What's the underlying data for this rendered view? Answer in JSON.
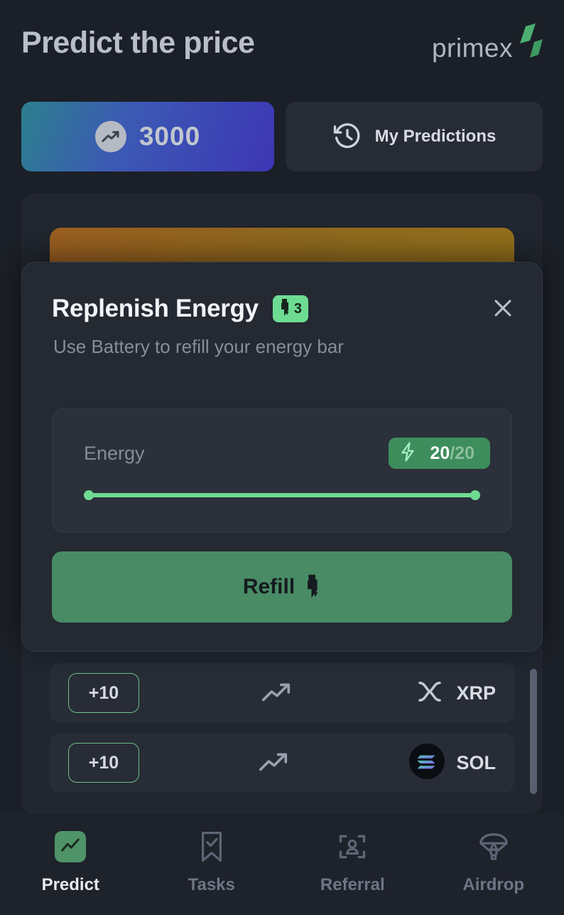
{
  "header": {
    "title": "Predict the price",
    "logo_text": "primex",
    "logo_icon": "primex-logo-mark",
    "logo_accent_color": "#4caf70"
  },
  "top_actions": {
    "balance": {
      "icon": "coin-trending-icon",
      "value": "3000"
    },
    "my_predictions": {
      "icon": "history-clock-icon",
      "label": "My Predictions"
    }
  },
  "promo_card": {
    "icon": "chart-orb-icon",
    "accent_color": "#9a5f20"
  },
  "asset_list": {
    "rows": [
      {
        "reward": "+10",
        "trend_icon": "trending-up-icon",
        "coin_icon": "xrp-icon",
        "symbol": "XRP"
      },
      {
        "reward": "+10",
        "trend_icon": "trending-up-icon",
        "coin_icon": "sol-icon",
        "symbol": "SOL"
      }
    ]
  },
  "modal": {
    "title": "Replenish Energy",
    "battery_badge": {
      "icon": "battery-bolt-icon",
      "count": "3",
      "color": "#6ddc92"
    },
    "close_icon": "close-icon",
    "subtitle": "Use Battery to refill your energy bar",
    "energy": {
      "label": "Energy",
      "bolt_icon": "lightning-bolt-icon",
      "current": "20",
      "max": "/20",
      "fill_percent": 100,
      "fill_color": "#6edb92"
    },
    "refill_button": {
      "label": "Refill",
      "icon": "battery-bolt-icon",
      "color": "#488b64"
    }
  },
  "bottom_nav": {
    "items": [
      {
        "label": "Predict",
        "icon": "chart-line-icon",
        "active": true
      },
      {
        "label": "Tasks",
        "icon": "bookmark-check-icon",
        "active": false
      },
      {
        "label": "Referral",
        "icon": "person-scan-icon",
        "active": false
      },
      {
        "label": "Airdrop",
        "icon": "parachute-icon",
        "active": false
      }
    ]
  }
}
